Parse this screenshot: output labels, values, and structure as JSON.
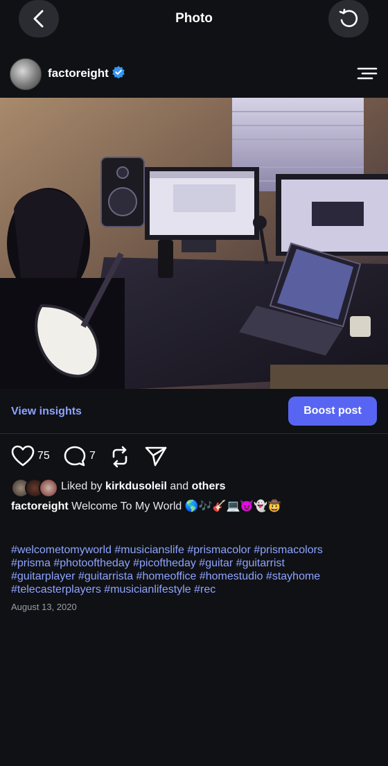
{
  "topbar": {
    "title": "Photo",
    "back_icon": "chevron-left-icon",
    "refresh_icon": "refresh-icon"
  },
  "post": {
    "username": "factoreight",
    "verified": true,
    "menu_icon": "menu-icon",
    "photo_description_icon": "photo"
  },
  "insights": {
    "view_label": "View insights",
    "boost_label": "Boost post",
    "link_color": "#8fa4ff",
    "button_color": "#5865f2"
  },
  "actions": {
    "likes": "75",
    "comments": "7",
    "icons": [
      "heart-icon",
      "comment-icon",
      "repost-icon",
      "share-icon"
    ]
  },
  "liked_by": {
    "prefix": "Liked by",
    "user": "kirkdusoleil",
    "joiner": "and",
    "suffix": "others"
  },
  "caption": {
    "username": "factoreight",
    "text": "Welcome To My World 🌎🎶🎸💻😈👻🤠"
  },
  "hashtags": {
    "line1": "#welcometomyworld #musicianslife #prismacolor #prismacolors",
    "line2": "#prisma #photooftheday #picoftheday #guitar #guitarrist",
    "line3": "#guitarplayer #guitarrista #homeoffice #homestudio #stayhome",
    "line4": "#telecasterplayers #musicianlifestyle #rec"
  },
  "date": "August 13, 2020"
}
